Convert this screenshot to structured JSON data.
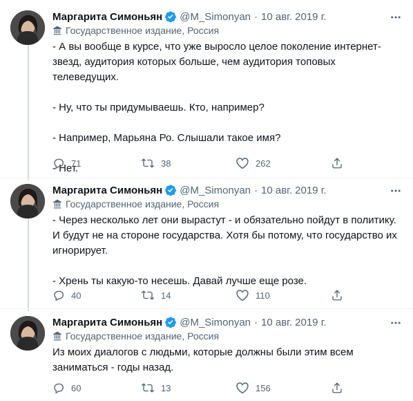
{
  "tweets": [
    {
      "author_name": "Маргарита Симоньян",
      "handle": "@M_Simonyan",
      "dot": "·",
      "date": "10 авг. 2019 г.",
      "label": "Государственное издание, Россия",
      "paragraphs": [
        "- А вы вообще в курсе, что уже выросло целое поколение интернет-звезд, аудитория которых больше, чем аудитория топовых телеведущих.",
        "- Ну, что ты придумываешь. Кто, например?",
        "- Например, Марьяна Ро. Слышали такое имя?",
        "- Нет."
      ],
      "replies": "71",
      "retweets": "38",
      "likes": "262"
    },
    {
      "author_name": "Маргарита Симоньян",
      "handle": "@M_Simonyan",
      "dot": "·",
      "date": "10 авг. 2019 г.",
      "label": "Государственное издание, Россия",
      "paragraphs": [
        "- Через несколько лет они вырастут - и обязательно пойдут в политику. И будут не на стороне государства. Хотя бы потому, что государство их игнорирует.",
        "- Хрень ты какую-то несешь. Давай лучше еще розе."
      ],
      "replies": "40",
      "retweets": "14",
      "likes": "110"
    },
    {
      "author_name": "Маргарита Симоньян",
      "handle": "@M_Simonyan",
      "dot": "·",
      "date": "10 авг. 2019 г.",
      "label": "Государственное издание, Россия",
      "paragraphs": [
        "Из моих диалогов с людьми, которые должны были этим всем заниматься - годы назад."
      ],
      "replies": "60",
      "retweets": "13",
      "likes": "156"
    }
  ],
  "icons": {
    "more": "more-horizontal-icon",
    "verified": "verified-badge-icon",
    "label": "state-media-icon",
    "reply": "reply-icon",
    "retweet": "retweet-icon",
    "like": "like-icon",
    "share": "share-icon"
  },
  "colors": {
    "verified": "#1d9bf0",
    "secondary_text": "#536471",
    "primary_text": "#0f1419",
    "thread_line": "#cfd9de"
  }
}
